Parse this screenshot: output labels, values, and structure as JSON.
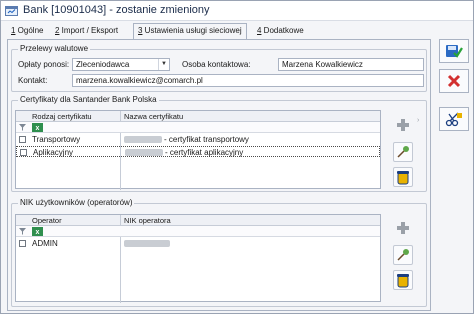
{
  "window": {
    "title": "Bank [10901043] - zostanie zmieniony",
    "close_glyph": "×"
  },
  "tabs": [
    {
      "key": "1",
      "label": " Ogólne"
    },
    {
      "key": "2",
      "label": " Import / Eksport"
    },
    {
      "key": "3",
      "label": " Ustawienia usługi sieciowej"
    },
    {
      "key": "4",
      "label": " Dodatkowe"
    }
  ],
  "transfers": {
    "title": "Przelewy walutowe",
    "fees_label": "Opłaty ponosi:",
    "fees_value": "Zleceniodawca",
    "contact_person_label": "Osoba kontaktowa:",
    "contact_person_value": "Marzena Kowalkiewicz",
    "contact_label": "Kontakt:",
    "contact_value": "marzena.kowalkiewicz@comarch.pl"
  },
  "certificates": {
    "title": "Certyfikaty dla Santander Bank Polska",
    "columns": [
      "Rodzaj certyfikatu",
      "Nazwa certyfikatu"
    ],
    "rows": [
      {
        "type": "Transportowy",
        "name": "- certyfikat transportowy"
      },
      {
        "type": "Aplikacyjny",
        "name": "- certyfikat aplikacyjny"
      }
    ]
  },
  "nik": {
    "title": "NIK użytkowników (operatorów)",
    "columns": [
      "Operator",
      "NIK operatora"
    ],
    "rows": [
      {
        "operator": "ADMIN"
      }
    ]
  },
  "icons": {
    "app": "bank-window-icon",
    "save": "save-icon",
    "cancel": "cancel-icon",
    "filter": "filter-icon",
    "excel": "excel-icon",
    "add": "add-icon",
    "edit": "edit-pin-icon",
    "delete": "trash-icon",
    "tools": "scissors-icon"
  },
  "colors": {
    "accent": "#1b5fbf",
    "cancel_red": "#d23030",
    "add_grey": "#9aa0a8"
  }
}
